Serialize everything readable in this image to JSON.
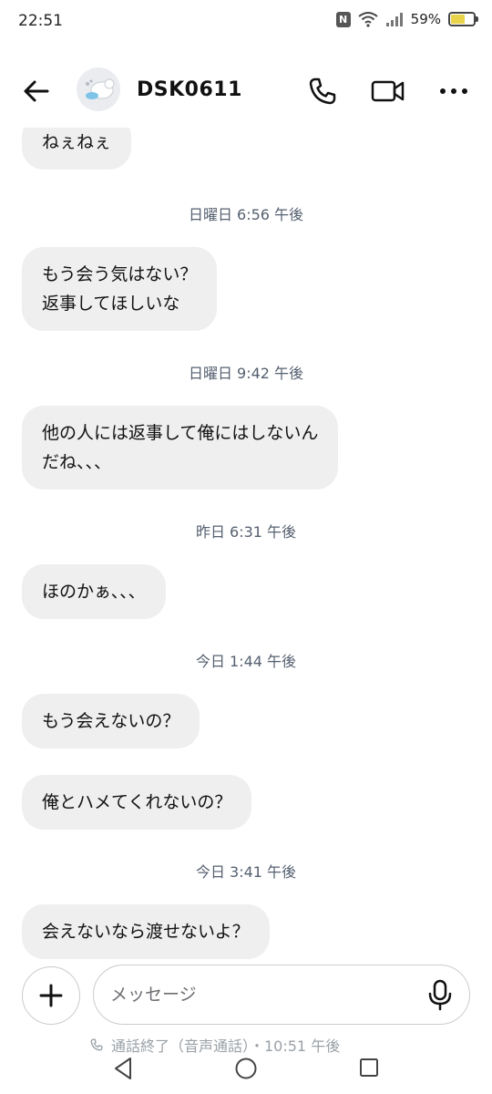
{
  "status_bar": {
    "time": "22:51",
    "nfc_label": "N",
    "battery_text": "59%",
    "battery_level": 0.59,
    "icons": [
      "nfc-icon",
      "wifi-icon",
      "signal-icon",
      "battery-icon"
    ]
  },
  "header": {
    "contact_name": "DSK0611",
    "icons": [
      "back-arrow-icon",
      "avatar-image",
      "phone-icon",
      "video-camera-icon",
      "more-dots-icon"
    ]
  },
  "messages": [
    {
      "kind": "bubble",
      "text": "ねぇねぇ"
    },
    {
      "kind": "timestamp",
      "text": "日曜日 6:56 午後"
    },
    {
      "kind": "bubble",
      "text": "もう会う気はない？\n返事してほしいな"
    },
    {
      "kind": "timestamp",
      "text": "日曜日 9:42 午後"
    },
    {
      "kind": "bubble",
      "text": "他の人には返事して俺にはしないん\nだね、、、"
    },
    {
      "kind": "timestamp",
      "text": "昨日 6:31 午後"
    },
    {
      "kind": "bubble",
      "text": "ほのかぁ、、、"
    },
    {
      "kind": "timestamp",
      "text": "今日 1:44 午後"
    },
    {
      "kind": "bubble",
      "text": "もう会えないの？"
    },
    {
      "kind": "bubble",
      "text": "俺とハメてくれないの？"
    },
    {
      "kind": "timestamp",
      "text": "今日 3:41 午後"
    },
    {
      "kind": "bubble",
      "text": "会えないなら渡せないよ？"
    }
  ],
  "composer": {
    "placeholder": "メッセージ",
    "icons": [
      "plus-icon",
      "microphone-icon"
    ]
  },
  "call_ended": {
    "text": "通話終了（音声通話）・10:51 午後",
    "icon": "phone-icon"
  },
  "nav_bar": {
    "icons": [
      "nav-back-icon",
      "nav-home-icon",
      "nav-recent-icon"
    ]
  },
  "colors": {
    "bubble_bg": "#efefef",
    "timestamp_text": "#556070",
    "border": "#c9ccd1",
    "battery_fill": "#e8d34a"
  }
}
